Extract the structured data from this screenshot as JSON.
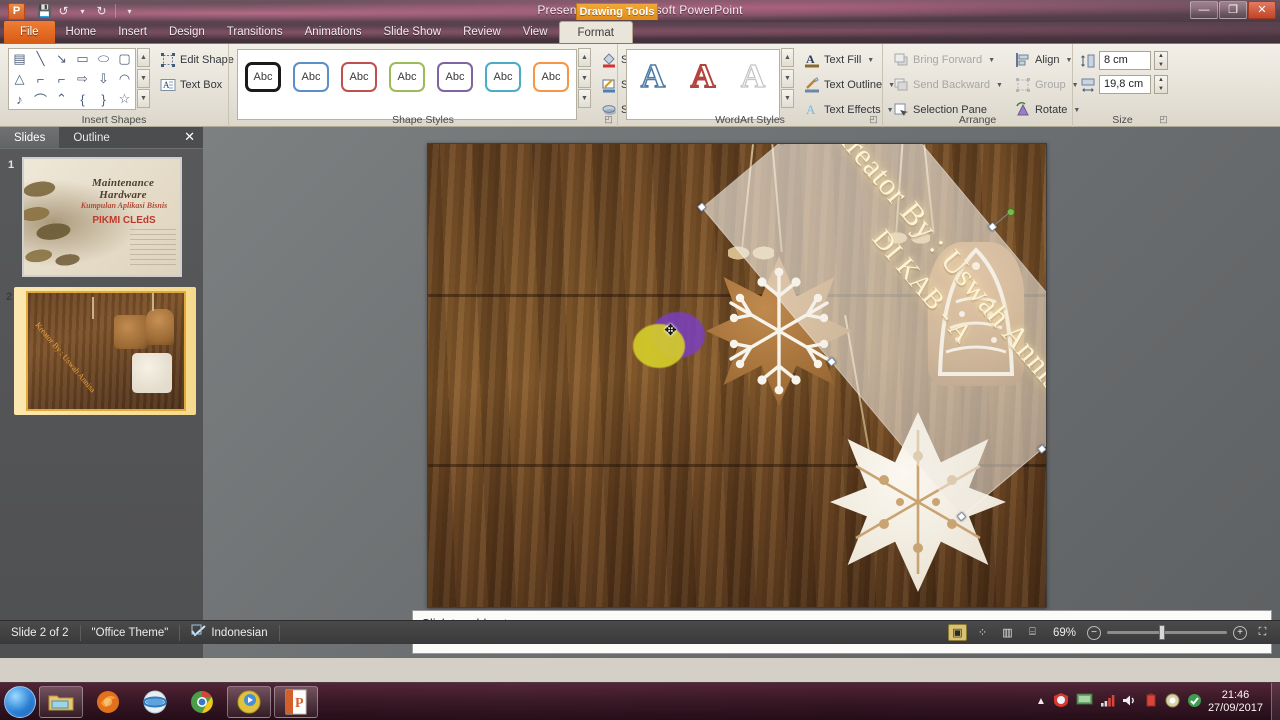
{
  "window": {
    "title": "Presentation1  -  Microsoft PowerPoint",
    "contextual_banner": "Drawing Tools",
    "app_logo": "P",
    "minimize": "—",
    "maximize": "❐",
    "close": "✕"
  },
  "quick_access": [
    {
      "name": "save-icon",
      "glyph": "💾"
    },
    {
      "name": "undo-icon",
      "glyph": "↺"
    },
    {
      "name": "undo-dropdown-icon",
      "glyph": "▾"
    },
    {
      "name": "redo-icon",
      "glyph": "↻"
    },
    {
      "name": "customize-qat-icon",
      "glyph": "▾"
    }
  ],
  "tabs": [
    {
      "label": "File",
      "active": false,
      "file": true
    },
    {
      "label": "Home",
      "active": false
    },
    {
      "label": "Insert",
      "active": false
    },
    {
      "label": "Design",
      "active": false
    },
    {
      "label": "Transitions",
      "active": false
    },
    {
      "label": "Animations",
      "active": false
    },
    {
      "label": "Slide Show",
      "active": false
    },
    {
      "label": "Review",
      "active": false
    },
    {
      "label": "View",
      "active": false
    },
    {
      "label": "Format",
      "active": true
    }
  ],
  "ribbon": {
    "groups": [
      {
        "name": "insert-shapes",
        "label": "Insert Shapes"
      },
      {
        "name": "shape-styles",
        "label": "Shape Styles"
      },
      {
        "name": "wordart-styles",
        "label": "WordArt Styles"
      },
      {
        "name": "arrange",
        "label": "Arrange"
      },
      {
        "name": "size",
        "label": "Size"
      }
    ],
    "insert_shapes": {
      "shape_glyphs": [
        "▤",
        "╲",
        "↘",
        "▭",
        "⬭",
        "▢",
        "△",
        "⌐",
        "⌐",
        "⇨",
        "⇩",
        "◠",
        "♪",
        "⌒",
        "⌃",
        "{",
        "}",
        "☆"
      ],
      "buttons": [
        {
          "label": "Edit Shape",
          "icon": "edit-shape-icon",
          "dropdown": true
        },
        {
          "label": "Text Box",
          "icon": "text-box-icon",
          "dropdown": false
        }
      ]
    },
    "shape_styles": {
      "swatches": [
        {
          "name": "style-black",
          "color": "#1a1a1a",
          "text": "Abc",
          "selected": true
        },
        {
          "name": "style-blue",
          "color": "#5b8fc9",
          "text": "Abc",
          "selected": false
        },
        {
          "name": "style-red",
          "color": "#c0504d",
          "text": "Abc",
          "selected": false
        },
        {
          "name": "style-green",
          "color": "#9bbb59",
          "text": "Abc",
          "selected": false
        },
        {
          "name": "style-purple",
          "color": "#8064a2",
          "text": "Abc",
          "selected": false
        },
        {
          "name": "style-cyan",
          "color": "#4bacc6",
          "text": "Abc",
          "selected": false
        },
        {
          "name": "style-orange",
          "color": "#f79646",
          "text": "Abc",
          "selected": false
        }
      ],
      "buttons": [
        {
          "label": "Shape Fill",
          "icon": "shape-fill-icon",
          "dropdown": true
        },
        {
          "label": "Shape Outline",
          "icon": "shape-outline-icon",
          "dropdown": true
        },
        {
          "label": "Shape Effects",
          "icon": "shape-effects-icon",
          "dropdown": true
        }
      ]
    },
    "wordart_styles": {
      "swatches": [
        {
          "name": "wordart-blue",
          "letter": "A",
          "color": "#4a7ba8"
        },
        {
          "name": "wordart-red",
          "letter": "A",
          "color": "#b4443f"
        },
        {
          "name": "wordart-gray",
          "letter": "A",
          "color": "#bdbdbd"
        }
      ],
      "buttons": [
        {
          "label": "Text Fill",
          "icon": "text-fill-icon",
          "dropdown": true
        },
        {
          "label": "Text Outline",
          "icon": "text-outline-icon",
          "dropdown": true
        },
        {
          "label": "Text Effects",
          "icon": "text-effects-icon",
          "dropdown": true
        }
      ]
    },
    "arrange": {
      "buttons": [
        {
          "label": "Bring Forward",
          "icon": "bring-forward-icon",
          "dropdown": true,
          "disabled": true
        },
        {
          "label": "Send Backward",
          "icon": "send-backward-icon",
          "dropdown": true,
          "disabled": true
        },
        {
          "label": "Selection Pane",
          "icon": "selection-pane-icon",
          "dropdown": false,
          "disabled": false
        },
        {
          "label": "Align",
          "icon": "align-icon",
          "dropdown": true,
          "disabled": false
        },
        {
          "label": "Group",
          "icon": "group-icon",
          "dropdown": true,
          "disabled": true
        },
        {
          "label": "Rotate",
          "icon": "rotate-icon",
          "dropdown": true,
          "disabled": false
        }
      ]
    },
    "size": {
      "height_label": "shape-height",
      "height_value": "8 cm",
      "width_label": "shape-width",
      "width_value": "19,8 cm"
    }
  },
  "slide_pane": {
    "tabs": [
      {
        "label": "Slides",
        "active": true
      },
      {
        "label": "Outline",
        "active": false
      }
    ],
    "close_glyph": "✕",
    "slides": [
      {
        "number": "1",
        "selected": false,
        "title": "Maintenance Hardware",
        "subtitle": "Kumpulan Aplikasi Bisnis",
        "tagline": "PIKMI CLEdS"
      },
      {
        "number": "2",
        "selected": true,
        "shape_text": "Kreator By : Uswah Annisa"
      }
    ]
  },
  "slide": {
    "shape_text_line1": "Kreator By : Uswah Annisa",
    "shape_text_line2": "DI KAB - A",
    "selected": true,
    "rotation_deg": 50,
    "accent_blob_purple": "#7b3fbf",
    "accent_blob_yellow": "#d6cf2a",
    "rotate_handle_color": "#76c043"
  },
  "notes": {
    "placeholder": "Click to add notes"
  },
  "status_bar": {
    "slide_counter": "Slide 2 of 2",
    "theme": "\"Office Theme\"",
    "language": "Indonesian",
    "spellcheck_icon": "spellcheck-icon",
    "zoom_percent": "69%",
    "zoom_out_glyph": "−",
    "zoom_in_glyph": "+",
    "fit_glyph": "⛶",
    "views": [
      {
        "name": "normal-view-button",
        "glyph": "▣",
        "active": true
      },
      {
        "name": "slide-sorter-button",
        "glyph": "⁘",
        "active": false
      },
      {
        "name": "reading-view-button",
        "glyph": "▥",
        "active": false
      },
      {
        "name": "slideshow-button",
        "glyph": "⌸",
        "active": false
      }
    ]
  },
  "taskbar": {
    "start": "start-orb",
    "items": [
      {
        "name": "windows-explorer-icon",
        "pinned": true,
        "color": "#e8b24a"
      },
      {
        "name": "firefox-icon",
        "pinned": false,
        "color": "#e3701a"
      },
      {
        "name": "internet-explorer-icon",
        "pinned": false,
        "color": "#3c8fd6"
      },
      {
        "name": "google-chrome-icon",
        "pinned": false,
        "color": "#d6453a"
      },
      {
        "name": "media-player-icon",
        "pinned": true,
        "color": "#e0c23c"
      },
      {
        "name": "powerpoint-icon",
        "pinned": true,
        "color": "#d2602a"
      }
    ],
    "tray": [
      {
        "name": "show-hidden-icons",
        "glyph": "▲"
      },
      {
        "name": "antivirus-icon",
        "glyph": "◆"
      },
      {
        "name": "network-monitor-icon",
        "glyph": "▤"
      },
      {
        "name": "signal-icon",
        "glyph": "▮"
      },
      {
        "name": "volume-icon",
        "glyph": "🔊"
      },
      {
        "name": "battery-icon",
        "glyph": "▯"
      },
      {
        "name": "update-icon",
        "glyph": "◉"
      },
      {
        "name": "security-icon",
        "glyph": "✔"
      }
    ],
    "clock_time": "21:46",
    "clock_date": "27/09/2017"
  }
}
